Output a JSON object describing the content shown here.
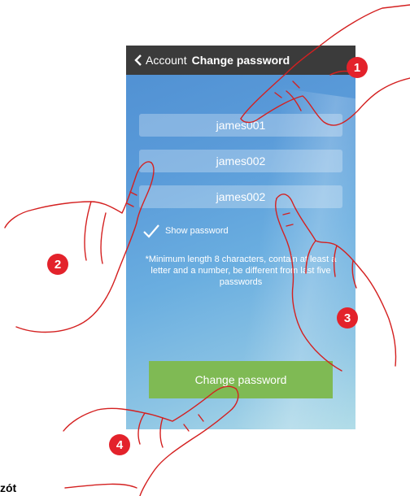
{
  "header": {
    "back_label": "Account",
    "title": "Change password"
  },
  "fields": {
    "old_password": "james001",
    "new_password": "james002",
    "confirm_password": "james002"
  },
  "show_password": {
    "label": "Show password",
    "checked": true
  },
  "note": "*Minimum length 8 characters, contain at least a letter and a number, be different from last five passwords",
  "button": {
    "label": "Change password"
  },
  "badges": {
    "b1": "1",
    "b2": "2",
    "b3": "3",
    "b4": "4"
  },
  "footer_text": "zót",
  "colors": {
    "topbar": "#3b3b3b",
    "button": "#7fba54",
    "badge": "#e3222b",
    "hand_outline": "#d42020"
  }
}
